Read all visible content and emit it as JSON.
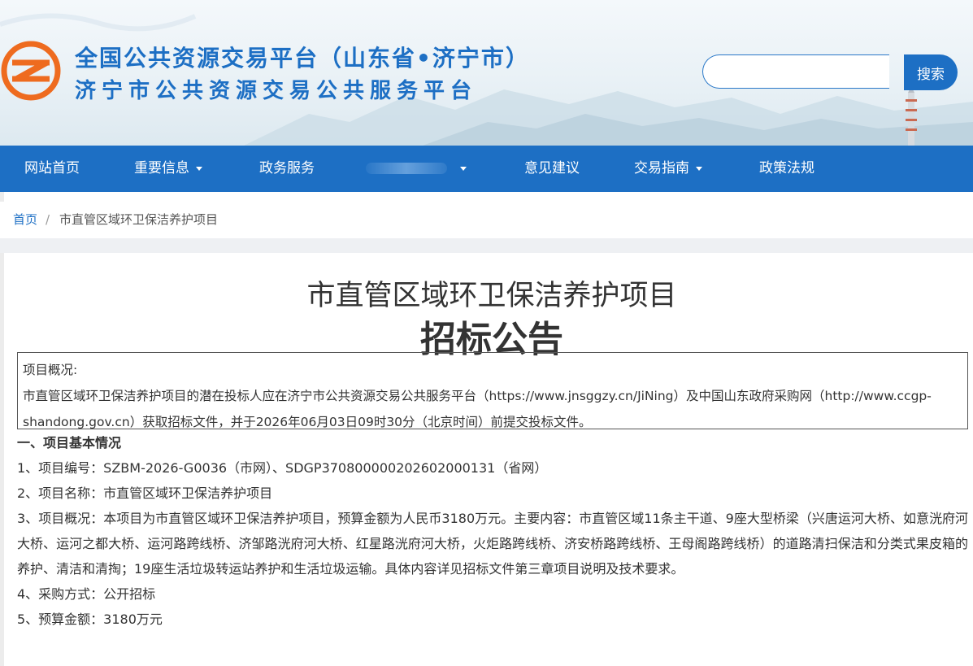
{
  "header": {
    "title_line1": "全国公共资源交易平台（山东省•济宁市）",
    "title_line2": "济宁市公共资源交易公共服务平台",
    "search": {
      "placeholder": "",
      "value": "",
      "button_label": "搜索"
    }
  },
  "nav": {
    "items": [
      {
        "label": "网站首页",
        "has_dropdown": false
      },
      {
        "label": "重要信息",
        "has_dropdown": true
      },
      {
        "label": "政务服务",
        "has_dropdown": false
      },
      {
        "label": "",
        "has_dropdown": true
      },
      {
        "label": "意见建议",
        "has_dropdown": false
      },
      {
        "label": "交易指南",
        "has_dropdown": true
      },
      {
        "label": "政策法规",
        "has_dropdown": false
      }
    ]
  },
  "breadcrumb": {
    "home": "首页",
    "separator": "/",
    "current": "市直管区域环卫保洁养护项目"
  },
  "document": {
    "title": "市直管区域环卫保洁养护项目",
    "subtitle": "招标公告",
    "overview_label": "项目概况:",
    "overview_text": "市直管区域环卫保洁养护项目的潜在投标人应在济宁市公共资源交易公共服务平台（https://www.jnsggzy.cn/JiNing）及中国山东政府采购网（http://www.ccgp-shandong.gov.cn）获取招标文件，并于2026年06月03日09时30分（北京时间）前提交投标文件。",
    "section1_heading": "一、项目基本情况",
    "items": [
      "1、项目编号：SZBM-2026-G0036（市网）、SDGP370800000202602000131（省网）",
      "2、项目名称：市直管区域环卫保洁养护项目",
      "3、项目概况：本项目为市直管区域环卫保洁养护项目，预算金额为人民币3180万元。主要内容：市直管区域11条主干道、9座大型桥梁（兴唐运河大桥、如意洸府河大桥、运河之都大桥、运河路跨线桥、济邹路洸府河大桥、红星路洸府河大桥，火炬路跨线桥、济安桥路跨线桥、王母阁路跨线桥）的道路清扫保洁和分类式果皮箱的养护、清洁和清掏；19座生活垃圾转运站养护和生活垃圾运输。具体内容详见招标文件第三章项目说明及技术要求。",
      "4、采购方式：公开招标",
      "5、预算金额：3180万元"
    ]
  },
  "colors": {
    "primary": "#1d6fc4",
    "logo_orange": "#ee6b1f",
    "background": "#ffffff",
    "band": "#eef0f3"
  }
}
